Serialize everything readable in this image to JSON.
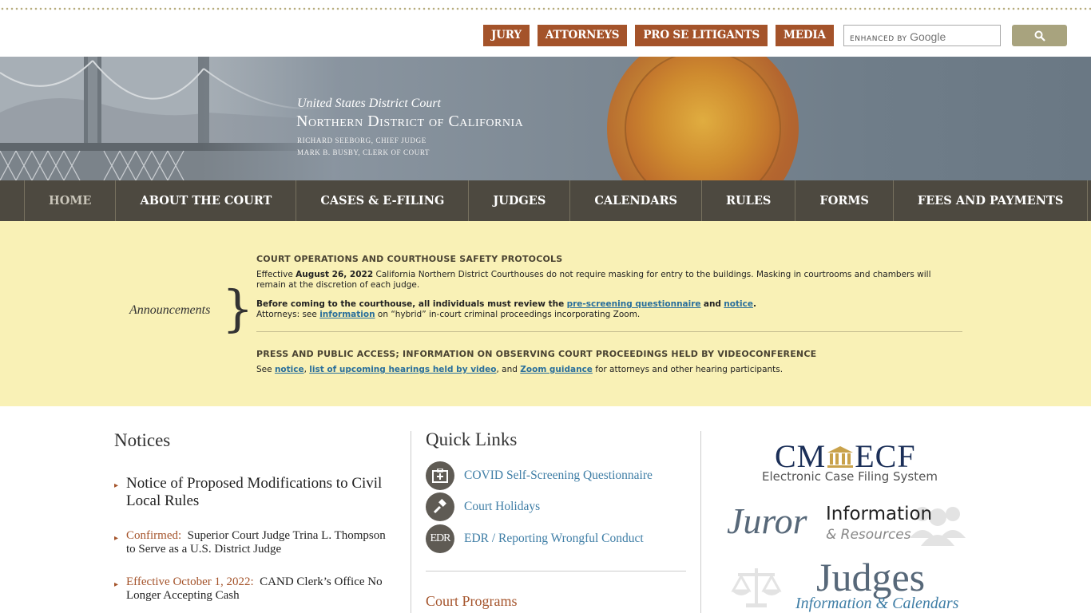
{
  "utility_nav": [
    "JURY",
    "ATTORNEYS",
    "PRO SE LITIGANTS",
    "MEDIA"
  ],
  "search": {
    "brand_prefix": "ENHANCED BY",
    "brand_name": "Google",
    "placeholder": ""
  },
  "banner": {
    "line1": "United States District Court",
    "line2": "Northern District of California",
    "line3": "RICHARD SEEBORG, CHIEF JUDGE",
    "line4": "MARK B. BUSBY, CLERK OF COURT"
  },
  "main_nav": [
    "HOME",
    "ABOUT THE COURT",
    "CASES & E-FILING",
    "JUDGES",
    "CALENDARS",
    "RULES",
    "FORMS",
    "FEES AND PAYMENTS"
  ],
  "announcements": {
    "label": "Announcements",
    "h1": "COURT OPERATIONS AND COURTHOUSE SAFETY PROTOCOLS",
    "p1_pre": "Effective",
    "p1_date": "August 26, 2022",
    "p1_post": "California Northern District Courthouses do not require masking for entry to the buildings.  Masking in courtrooms and chambers will remain at the discretion of each judge.",
    "p2_bold": "Before coming to the courthouse, all individuals must review the",
    "p2_link1": "pre-screening questionnaire",
    "p2_and": "and",
    "p2_link2": "notice",
    "p3_pre": "Attorneys: see",
    "p3_link": "information",
    "p3_post": "on “hybrid” in-court criminal proceedings incorporating Zoom.",
    "h2": "PRESS AND PUBLIC ACCESS; INFORMATION ON OBSERVING COURT PROCEEDINGS HELD BY VIDEOCONFERENCE",
    "p4_pre": "See",
    "p4_link1": "notice",
    "p4_link2": "list of upcoming hearings held by video",
    "p4_mid": ", and",
    "p4_link3": "Zoom guidance",
    "p4_post": "for attorneys and other hearing participants."
  },
  "notices": {
    "title": "Notices",
    "items": [
      {
        "accent": "",
        "text": "Notice of Proposed Modifications to Civil Local Rules"
      },
      {
        "accent": "Confirmed:",
        "text": "Superior Court Judge Trina L. Thompson to Serve as a U.S. District Judge"
      },
      {
        "accent": "Effective October 1, 2022:",
        "text": "CAND Clerk’s Office No Longer Accepting Cash"
      }
    ]
  },
  "quick_links": {
    "title": "Quick Links",
    "items": [
      {
        "label": "COVID Self-Screening Questionnaire",
        "icon": "medical-kit-icon"
      },
      {
        "label": "Court Holidays",
        "icon": "gavel-icon"
      },
      {
        "label": "EDR / Reporting Wrongful Conduct",
        "icon": "edr-icon",
        "icon_text": "EDR"
      }
    ],
    "court_programs": "Court Programs"
  },
  "promos": {
    "cmecf_left": "CM",
    "cmecf_right": "ECF",
    "cmecf_sub": "Electronic Case Filing System",
    "juror": "Juror",
    "juror_info": "Information",
    "juror_res": "& Resources",
    "judges": "Judges",
    "judges_sub": "Information & Calendars"
  },
  "colors": {
    "accent": "#a4532a",
    "nav_bg": "#4d4940",
    "announce_bg": "#f9f1b6",
    "link": "#2a6f9b"
  }
}
